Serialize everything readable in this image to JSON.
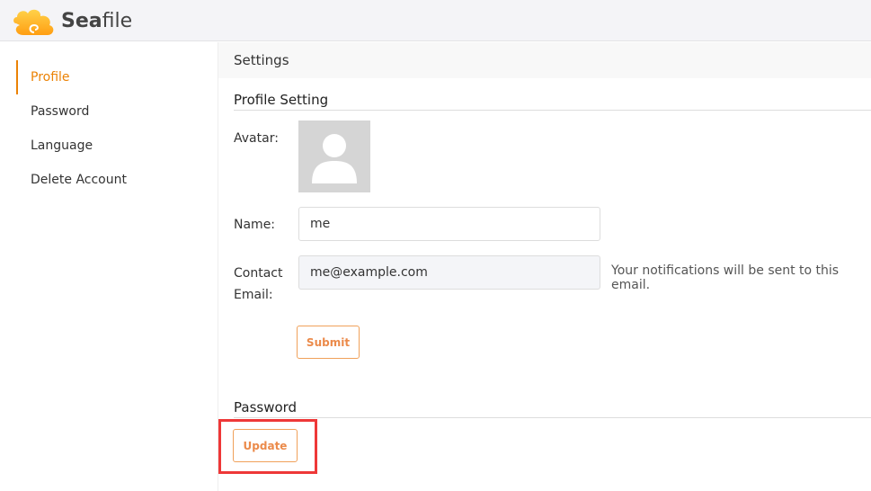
{
  "header": {
    "logo_text_bold": "Sea",
    "logo_text_rest": "file"
  },
  "sidebar": {
    "items": [
      {
        "label": "Profile",
        "active": true
      },
      {
        "label": "Password"
      },
      {
        "label": "Language"
      },
      {
        "label": "Delete Account"
      }
    ]
  },
  "main": {
    "title": "Settings",
    "profile": {
      "heading": "Profile Setting",
      "avatar_label": "Avatar:",
      "name_label": "Name:",
      "name_value": "me",
      "email_label_1": "Contact",
      "email_label_2": "Email:",
      "email_value": "me@example.com",
      "email_hint": "Your notifications will be sent to this email.",
      "submit_label": "Submit"
    },
    "password": {
      "heading": "Password",
      "update_label": "Update"
    }
  },
  "colors": {
    "accent": "#eb8205",
    "highlight": "#ee3838"
  }
}
